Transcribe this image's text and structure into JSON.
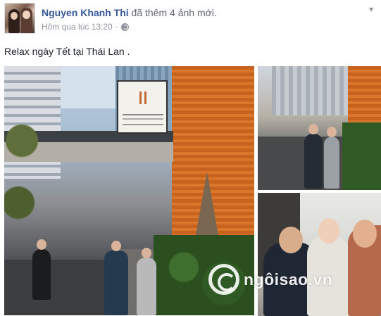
{
  "post": {
    "author": "Nguyen Khanh Thi",
    "action": " đã thêm 4 ảnh mới.",
    "timestamp": "Hôm qua lúc 13:20",
    "separator": "·",
    "privacy_icon": "globe-icon",
    "options_icon": "chevron-down-icon",
    "text": "Relax ngày Tết tại Thái Lan ."
  },
  "photos": [
    {
      "name": "street-sign-photo"
    },
    {
      "name": "couple-walking-photo"
    },
    {
      "name": "selfie-photo"
    }
  ],
  "watermark": {
    "text": "ngôisao.vn"
  },
  "colors": {
    "link": "#365899",
    "meta": "#90949c",
    "text": "#1d2129"
  }
}
